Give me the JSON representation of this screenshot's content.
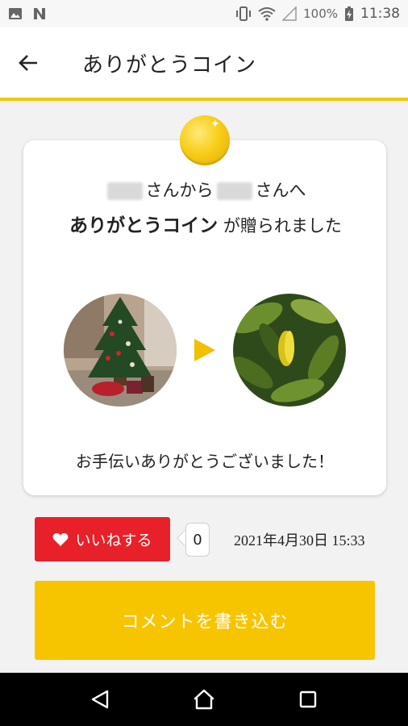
{
  "status_bar": {
    "battery": "100%",
    "time": "11:38"
  },
  "app_bar": {
    "title": "ありがとうコイン"
  },
  "card": {
    "from_to_text_1": "さんから",
    "from_to_text_2": "さんへ",
    "gift_strong": "ありがとうコイン",
    "gift_rest": "が贈られました",
    "message": "お手伝いありがとうございました！"
  },
  "actions": {
    "like_label": "いいねする",
    "like_count": "0",
    "timestamp": "2021年4月30日 15:33",
    "comment_label": "コメントを書き込む"
  },
  "colors": {
    "accent": "#f7c500",
    "like": "#e8202a",
    "coin": "#f7cf1a"
  },
  "icons": {
    "back": "arrow-left-icon",
    "like": "heart-icon",
    "nav_back": "nav-back-icon",
    "nav_home": "nav-home-icon",
    "nav_recents": "nav-recents-icon"
  }
}
